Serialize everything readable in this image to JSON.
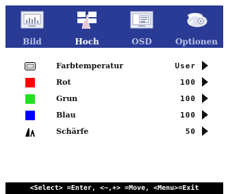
{
  "tabs": [
    {
      "label": "Bild",
      "icon": "picture-icon",
      "active": false
    },
    {
      "label": "Hoch",
      "icon": "advanced-hand-icon",
      "active": true
    },
    {
      "label": "OSD",
      "icon": "osd-screen-icon",
      "active": false
    },
    {
      "label": "Optionen",
      "icon": "options-hand-icon",
      "active": false
    }
  ],
  "rows": [
    {
      "label": "Farbtemperatur",
      "value": "User",
      "icon": "color-temperature-icon"
    },
    {
      "label": "Rot",
      "value": "100",
      "icon": "red-square-icon",
      "color": "#ff0000"
    },
    {
      "label": "Grun",
      "value": "100",
      "icon": "green-square-icon",
      "color": "#22e01f"
    },
    {
      "label": "Blau",
      "value": "100",
      "icon": "blue-square-icon",
      "color": "#0000ff"
    },
    {
      "label": "Schärfe",
      "value": "50",
      "icon": "sharpness-icon"
    }
  ],
  "footer": "<Select> =Enter, <−,+> =Move, <Menu>=Exit",
  "colors": {
    "tabbar": "#2a3b96",
    "footer": "#000000"
  }
}
